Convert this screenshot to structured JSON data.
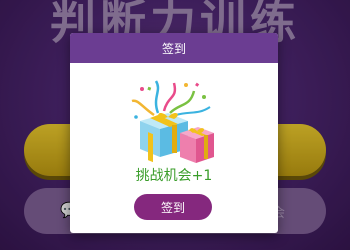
{
  "background": {
    "title": "判断力训练",
    "bar_text": "会"
  },
  "modal": {
    "title": "签到",
    "reward_text": "挑战机会+1",
    "button_label": "签到",
    "gift_icon": "gift-boxes-icon"
  },
  "colors": {
    "header": "#6b3d92",
    "button": "#85287e",
    "reward_text": "#3a9d2a",
    "start_button": "#e6c52d"
  }
}
